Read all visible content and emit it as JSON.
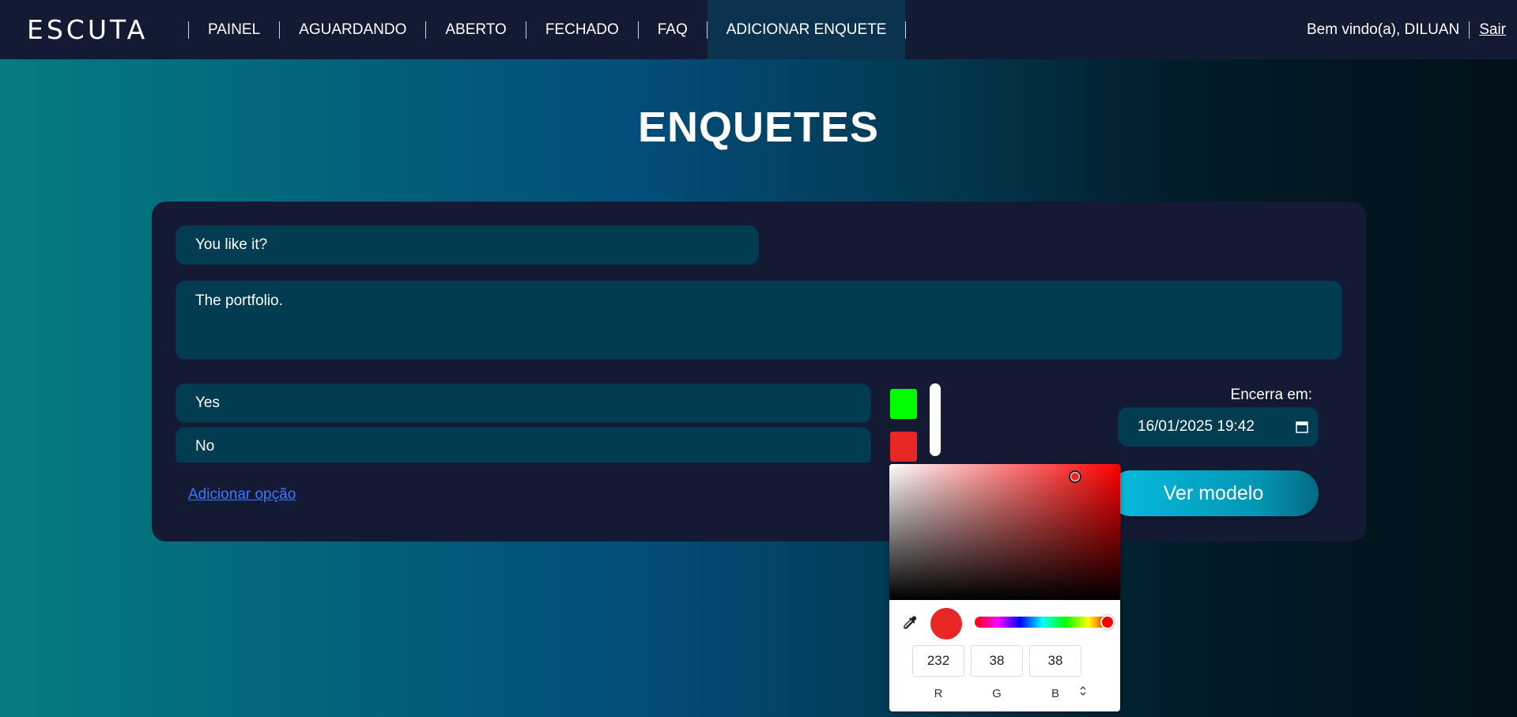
{
  "nav": {
    "logo": "ESCUTA",
    "links": [
      "PAINEL",
      "AGUARDANDO",
      "ABERTO",
      "FECHADO",
      "FAQ",
      "ADICIONAR ENQUETE"
    ],
    "active": "ADICIONAR ENQUETE",
    "welcome": "Bem vindo(a), DILUAN",
    "logout": "Sair"
  },
  "page": {
    "title": "ENQUETES"
  },
  "form": {
    "question": "You like it?",
    "description": "The portfolio.",
    "options": [
      {
        "label": "Yes",
        "color": "#00ff00"
      },
      {
        "label": "No",
        "color": "#e82626"
      }
    ],
    "add_option": "Adicionar opção",
    "closes_label": "Encerra em:",
    "closes_value": "16/01/2025 19:42",
    "preview_button": "Ver modelo"
  },
  "color_picker": {
    "hue_color": "#ff0000",
    "selected": "#e82626",
    "r": "232",
    "g": "38",
    "b": "38",
    "labels": [
      "R",
      "G",
      "B"
    ]
  }
}
